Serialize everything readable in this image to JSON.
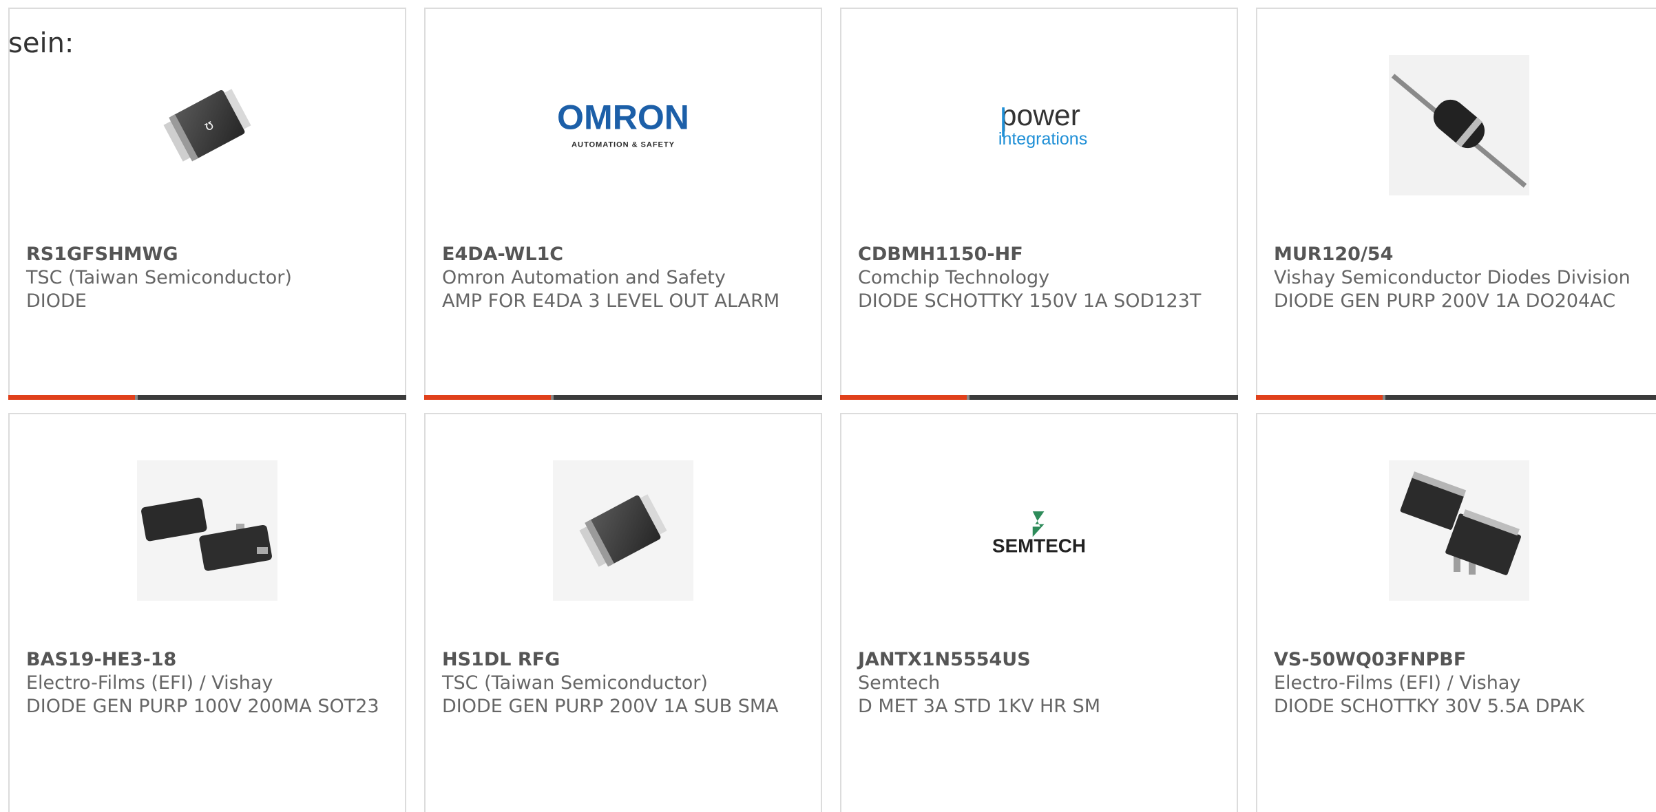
{
  "lead_text": "sein:",
  "colors": {
    "accent": "#e0401b",
    "bar": "#3b3b3b",
    "border": "#dcdcdc"
  },
  "products": [
    {
      "part": "RS1GFSHMWG",
      "maker": "TSC (Taiwan Semiconductor)",
      "desc": "DIODE",
      "image": "smd-diode-icon"
    },
    {
      "part": "E4DA-WL1C",
      "maker": "Omron Automation and Safety",
      "desc": "AMP FOR E4DA 3 LEVEL OUT ALARM",
      "image": "omron-logo",
      "logo_main": "OMRON",
      "logo_sub": "AUTOMATION & SAFETY"
    },
    {
      "part": "CDBMH1150-HF",
      "maker": "Comchip Technology",
      "desc": "DIODE SCHOTTKY 150V 1A SOD123T",
      "image": "power-integrations-logo",
      "logo_main": "power",
      "logo_sub": "integrations"
    },
    {
      "part": "MUR120/54",
      "maker": "Vishay Semiconductor Diodes Division",
      "desc": "DIODE GEN PURP 200V 1A DO204AC",
      "image": "axial-diode-icon"
    },
    {
      "part": "BAS19-HE3-18",
      "maker": "Electro-Films (EFI) / Vishay",
      "desc": "DIODE GEN PURP 100V 200MA SOT23",
      "image": "sot23-icon"
    },
    {
      "part": "HS1DL RFG",
      "maker": "TSC (Taiwan Semiconductor)",
      "desc": "DIODE GEN PURP 200V 1A SUB SMA",
      "image": "smd-diode-icon"
    },
    {
      "part": "JANTX1N5554US",
      "maker": "Semtech",
      "desc": "D MET 3A STD 1KV HR SM",
      "image": "semtech-logo",
      "logo_main": "SEMTECH"
    },
    {
      "part": "VS-50WQ03FNPBF",
      "maker": "Electro-Films (EFI) / Vishay",
      "desc": "DIODE SCHOTTKY 30V 5.5A DPAK",
      "image": "dpak-icon"
    }
  ]
}
